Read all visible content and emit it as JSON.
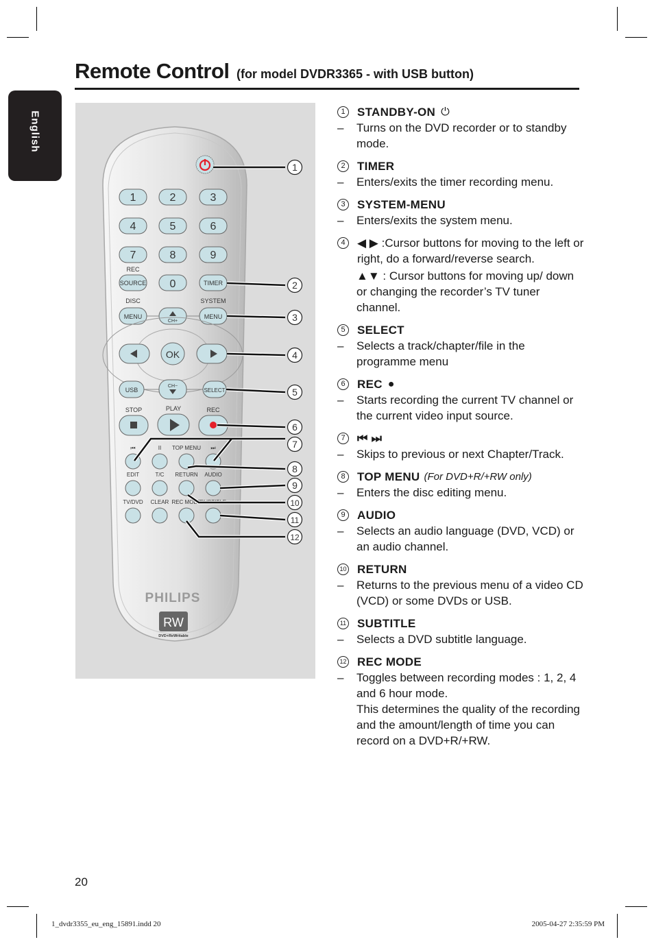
{
  "header": {
    "title": "Remote Control",
    "subtitle": "(for model DVDR3365 - with USB button)"
  },
  "side_tab": {
    "label": "English"
  },
  "remote": {
    "brand": "PHILIPS",
    "logo_text": "RW",
    "logo_caption": "DVD+ReWritable",
    "buttons": {
      "digits": [
        "1",
        "2",
        "3",
        "4",
        "5",
        "6",
        "7",
        "8",
        "9",
        "0"
      ],
      "source": "SOURCE",
      "source_label": "REC",
      "timer": "TIMER",
      "disc_label": "DISC",
      "disc_menu": "MENU",
      "ch_plus": "CH+",
      "system_label": "SYSTEM",
      "system_menu": "MENU",
      "ok": "OK",
      "usb": "USB",
      "ch_minus": "CH−",
      "select": "SELECT",
      "stop_label": "STOP",
      "play_label": "PLAY",
      "rec_label": "REC",
      "prev_label": "⏮",
      "pause_label": "II",
      "top_menu_label": "TOP MENU",
      "next_label": "⏭",
      "edit_label": "EDIT",
      "tc_label": "T/C",
      "return_label": "RETURN",
      "audio_label": "AUDIO",
      "tvdvd_label": "TV/DVD",
      "clear_label": "CLEAR",
      "recmode_label": "REC MODE",
      "subtitle_label": "SUBTITLE"
    },
    "callouts": [
      "1",
      "2",
      "3",
      "4",
      "5",
      "6",
      "7",
      "8",
      "9",
      "10",
      "11",
      "12"
    ],
    "colors": {
      "button_fill": "#c9e1e6",
      "power_red": "#e4202a",
      "rec_red": "#e4202a",
      "background": "#dcdcdc"
    }
  },
  "items": [
    {
      "num": "1",
      "label": "STANDBY-ON",
      "icon": "power-icon",
      "icon_glyph": "⏻",
      "lines": [
        "Turns on the DVD recorder or to standby mode."
      ]
    },
    {
      "num": "2",
      "label": "TIMER",
      "lines": [
        "Enters/exits the timer recording menu."
      ]
    },
    {
      "num": "3",
      "label": "SYSTEM-MENU",
      "lines": [
        "Enters/exits the system menu."
      ]
    },
    {
      "num": "4",
      "label": "◀ ▶ :Cursor buttons for moving to the left or right, do a forward/reverse search.",
      "extra": "▲▼ : Cursor buttons for moving up/ down or changing the recorder’s TV tuner channel."
    },
    {
      "num": "5",
      "label": "SELECT",
      "lines": [
        "Selects a track/chapter/file in the programme menu"
      ]
    },
    {
      "num": "6",
      "label": "REC",
      "icon": "record-dot-icon",
      "icon_glyph": "●",
      "lines": [
        "Starts recording the current TV channel or the current video input source."
      ]
    },
    {
      "num": "7",
      "label": "⏮ ⏭",
      "lines": [
        "Skips to previous or next Chapter/Track."
      ]
    },
    {
      "num": "8",
      "label": "TOP MENU",
      "note": "(For DVD+R/+RW only)",
      "lines": [
        "Enters the disc editing menu."
      ]
    },
    {
      "num": "9",
      "label": "AUDIO",
      "lines": [
        "Selects an audio language (DVD, VCD) or an audio channel."
      ]
    },
    {
      "num": "10",
      "label": "RETURN",
      "lines": [
        "Returns to the previous menu of a video CD (VCD) or some DVDs or USB."
      ]
    },
    {
      "num": "11",
      "label": "SUBTITLE",
      "lines": [
        "Selects a DVD subtitle language."
      ]
    },
    {
      "num": "12",
      "label": "REC MODE",
      "lines": [
        "Toggles between recording modes : 1, 2, 4 and 6 hour mode."
      ],
      "extra": "This determines the quality of the recording and the amount/length of time you can record on a DVD+R/+RW."
    }
  ],
  "footer": {
    "page_number": "20",
    "file": "1_dvdr3355_eu_eng_15891.indd   20",
    "timestamp": "2005-04-27   2:35:59 PM"
  }
}
